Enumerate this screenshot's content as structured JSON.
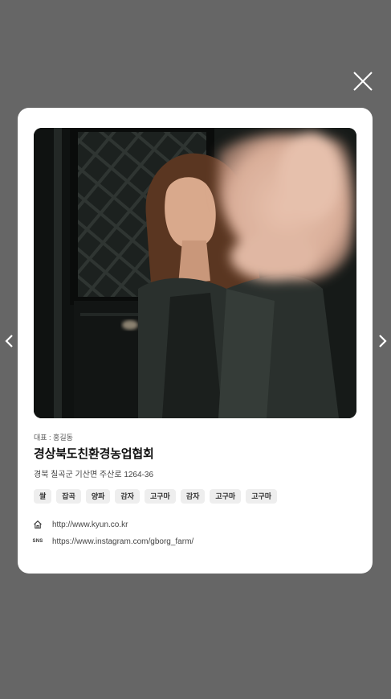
{
  "modal": {
    "close_icon": "close-icon",
    "prev_icon": "chevron-left-icon",
    "next_icon": "chevron-right-icon"
  },
  "profile": {
    "representative": "대표 : 홍길동",
    "name": "경상북도친환경농업협회",
    "address": "경북 칠곡군 기산면 주산로 1264-36",
    "tags": [
      "쌀",
      "잡곡",
      "양파",
      "감자",
      "고구마",
      "감자",
      "고구마",
      "고구마"
    ],
    "website": "http://www.kyun.co.kr",
    "sns_label": "SNS",
    "sns_url": "https://www.instagram.com/gborg_farm/"
  },
  "colors": {
    "overlay": "#666666",
    "card": "#ffffff",
    "tag_bg": "#eeeeee"
  }
}
